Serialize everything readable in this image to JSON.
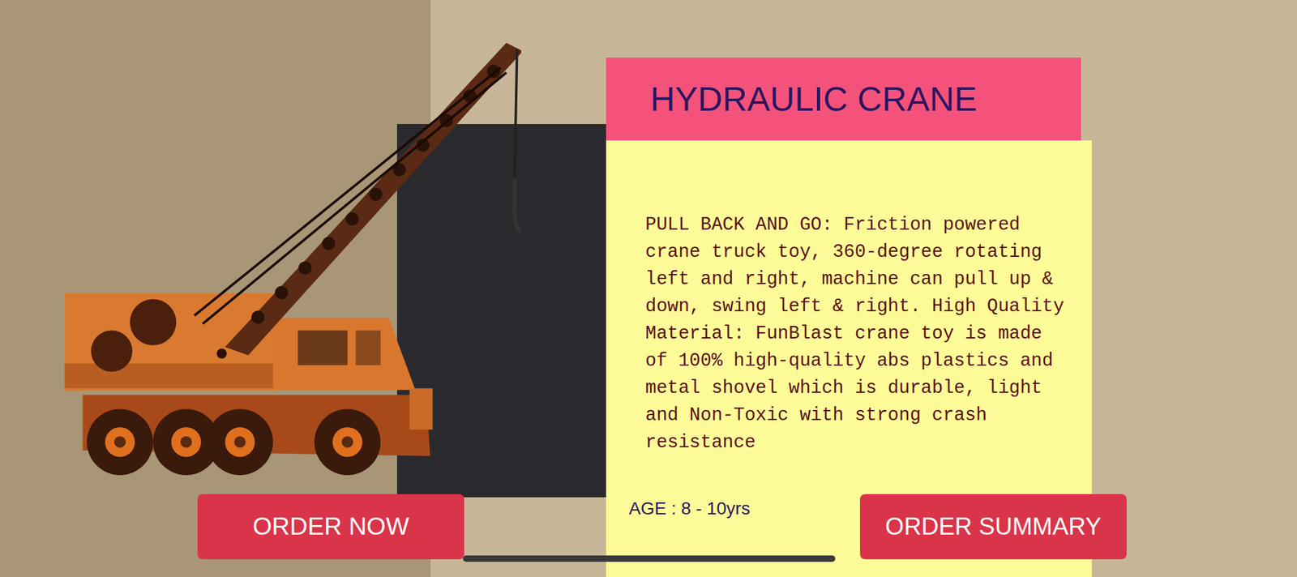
{
  "product": {
    "title": "HYDRAULIC CRANE",
    "description": "PULL BACK AND GO: Friction powered crane truck toy, 360-degree rotating left and right, machine can pull up & down, swing left & right. High Quality Material: FunBlast crane toy is made of 100% high-quality abs plastics and metal shovel which is durable, light and Non-Toxic with strong crash resistance",
    "age": "AGE : 8 - 10yrs"
  },
  "buttons": [
    "ORDER NOW",
    "ORDER SUMMARY"
  ]
}
